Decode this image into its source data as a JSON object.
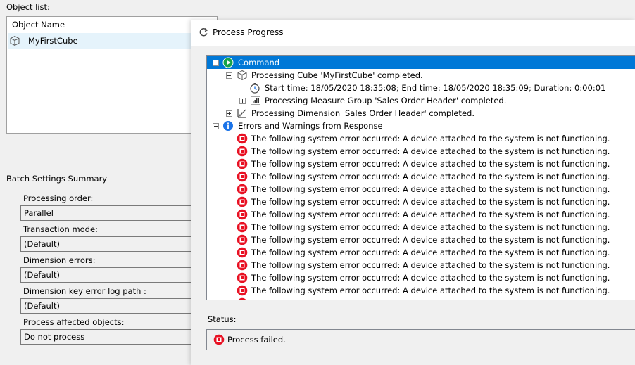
{
  "object_list": {
    "label": "Object list:",
    "column_header": "Object Name",
    "rows": [
      {
        "name": "MyFirstCube"
      }
    ]
  },
  "batch": {
    "title": "Batch Settings Summary",
    "settings": [
      {
        "label": "Processing order:",
        "value": "Parallel"
      },
      {
        "label": "Transaction mode:",
        "value": "(Default)"
      },
      {
        "label": "Dimension errors:",
        "value": "(Default)"
      },
      {
        "label": "Dimension key error log path :",
        "value": "(Default)"
      },
      {
        "label": "Process affected objects:",
        "value": "Do not process"
      }
    ]
  },
  "process_progress": {
    "title": "Process Progress",
    "command": "Command",
    "cube_processing": "Processing Cube 'MyFirstCube' completed.",
    "timing": "Start time: 18/05/2020 18:35:08; End time: 18/05/2020 18:35:09; Duration: 0:00:01",
    "measure_group": "Processing Measure Group 'Sales Order Header' completed.",
    "dimension": "Processing Dimension 'Sales Order Header' completed.",
    "errors_header": "Errors and Warnings from Response",
    "errors": [
      "The following system error occurred:  A device attached to the system is not functioning.",
      "The following system error occurred:  A device attached to the system is not functioning.",
      "The following system error occurred:  A device attached to the system is not functioning.",
      "The following system error occurred:  A device attached to the system is not functioning.",
      "The following system error occurred:  A device attached to the system is not functioning.",
      "The following system error occurred:  A device attached to the system is not functioning.",
      "The following system error occurred:  A device attached to the system is not functioning.",
      "The following system error occurred:  A device attached to the system is not functioning.",
      "The following system error occurred:  A device attached to the system is not functioning.",
      "The following system error occurred:  A device attached to the system is not functioning.",
      "The following system error occurred:  A device attached to the system is not functioning.",
      "The following system error occurred:  A device attached to the system is not functioning.",
      "The following system error occurred:  A device attached to the system is not functioning."
    ],
    "status_label": "Status:",
    "status_text": "Process failed."
  },
  "icons": {
    "command": "play-icon",
    "cube": "cube-icon",
    "clock": "clock-icon",
    "measure_group": "bar-chart-icon",
    "dimension": "dimension-icon",
    "info": "info-icon",
    "error": "error-icon",
    "refresh": "refresh-icon"
  },
  "colors": {
    "selection": "#0078d7",
    "error_red": "#e81123",
    "command_green": "#16a34a",
    "info_blue": "#1a73e8"
  }
}
